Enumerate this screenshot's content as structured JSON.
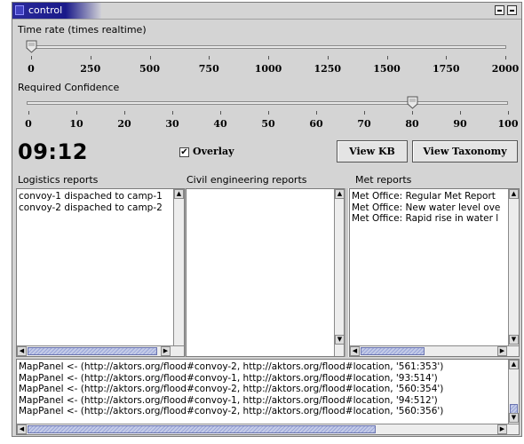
{
  "window": {
    "title": "control"
  },
  "time_rate": {
    "label": "Time rate (times realtime)",
    "ticks": [
      "0",
      "250",
      "500",
      "750",
      "1000",
      "1250",
      "1500",
      "1750",
      "2000"
    ],
    "value": 0
  },
  "confidence": {
    "label": "Required Confidence",
    "ticks": [
      "0",
      "10",
      "20",
      "30",
      "40",
      "50",
      "60",
      "70",
      "80",
      "90",
      "100"
    ],
    "value": 80
  },
  "clock": "09:12",
  "overlay": {
    "label": "Overlay",
    "checked": true
  },
  "buttons": {
    "view_kb": "View KB",
    "view_taxonomy": "View Taxonomy"
  },
  "panels": {
    "logistics": {
      "label": "Logistics reports",
      "items": [
        "convoy-1 dispached to camp-1",
        "convoy-2 dispached to camp-2"
      ]
    },
    "civil": {
      "label": "Civil engineering reports",
      "items": []
    },
    "met": {
      "label": "Met reports",
      "items": [
        "Met Office: Regular Met Report",
        "Met Office: New water level ove",
        "Met Office: Rapid rise in water l"
      ]
    }
  },
  "log": {
    "lines": [
      "MapPanel <- (http://aktors.org/flood#convoy-2, http://aktors.org/flood#location, '561:353')",
      "MapPanel <- (http://aktors.org/flood#convoy-1, http://aktors.org/flood#location, '93:514')",
      "MapPanel <- (http://aktors.org/flood#convoy-2, http://aktors.org/flood#location, '560:354')",
      "MapPanel <- (http://aktors.org/flood#convoy-1, http://aktors.org/flood#location, '94:512')",
      "MapPanel <- (http://aktors.org/flood#convoy-2, http://aktors.org/flood#location, '560:356')"
    ]
  }
}
